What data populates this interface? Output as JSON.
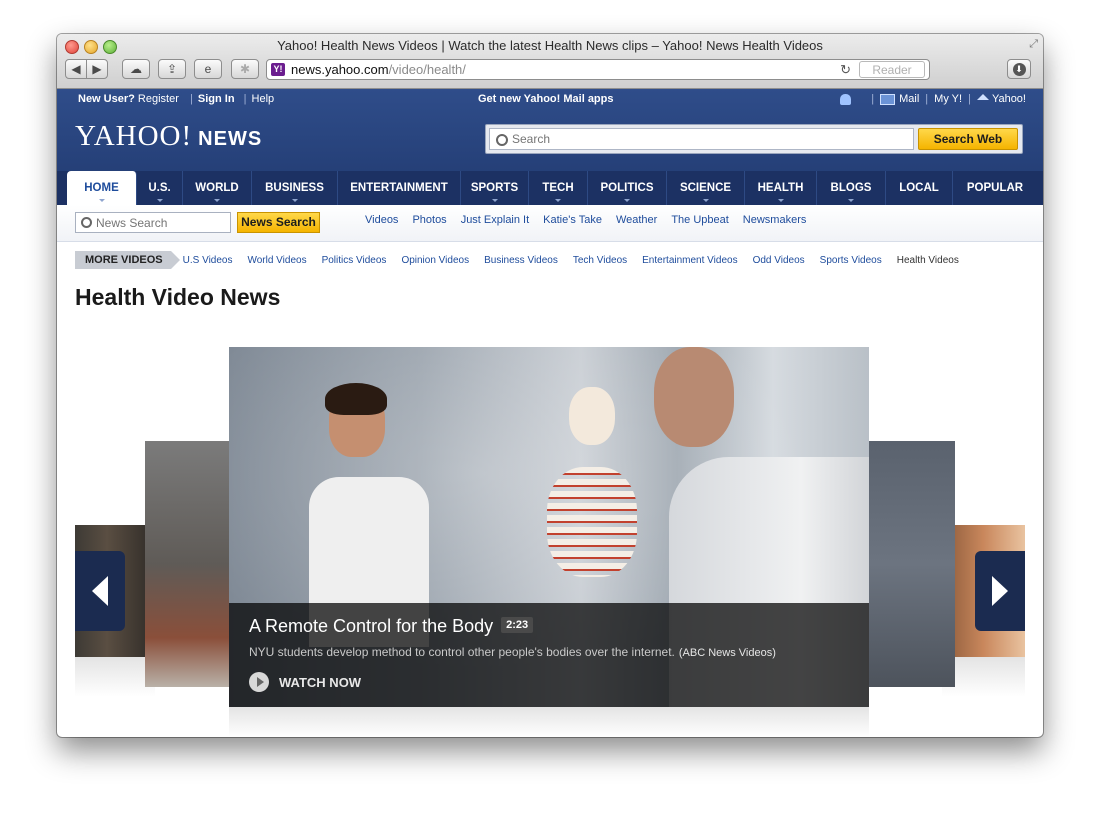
{
  "window": {
    "title": "Yahoo! Health News Videos | Watch the latest Health News clips – Yahoo! News Health Videos",
    "url_host": "news.yahoo.com",
    "url_path": "/video/health/",
    "reader_label": "Reader"
  },
  "header": {
    "new_user": "New User?",
    "register": "Register",
    "sign_in": "Sign In",
    "help": "Help",
    "mail_apps": "Get new Yahoo! Mail apps",
    "mail": "Mail",
    "my_y": "My Y!",
    "yahoo": "Yahoo!",
    "logo": "YAHOO!",
    "logo_news": "NEWS",
    "search_placeholder": "Search",
    "search_button": "Search Web"
  },
  "nav": {
    "items": [
      {
        "label": "HOME"
      },
      {
        "label": "U.S."
      },
      {
        "label": "WORLD"
      },
      {
        "label": "BUSINESS"
      },
      {
        "label": "ENTERTAINMENT"
      },
      {
        "label": "SPORTS"
      },
      {
        "label": "TECH"
      },
      {
        "label": "POLITICS"
      },
      {
        "label": "SCIENCE"
      },
      {
        "label": "HEALTH"
      },
      {
        "label": "BLOGS"
      },
      {
        "label": "LOCAL"
      },
      {
        "label": "POPULAR"
      }
    ]
  },
  "subnav": {
    "search_placeholder": "News Search",
    "search_button": "News Search",
    "links": [
      "Videos",
      "Photos",
      "Just Explain It",
      "Katie's Take",
      "Weather",
      "The Upbeat",
      "Newsmakers"
    ]
  },
  "more_videos": {
    "label": "MORE VIDEOS",
    "links": [
      "U.S Videos",
      "World Videos",
      "Politics Videos",
      "Opinion Videos",
      "Business Videos",
      "Tech Videos",
      "Entertainment Videos",
      "Odd Videos",
      "Sports Videos",
      "Health Videos"
    ]
  },
  "page_title": "Health Video News",
  "featured": {
    "title": "A Remote Control for the Body",
    "duration": "2:23",
    "description": "NYU students develop method to control other people's bodies over the internet.",
    "source": "(ABC News Videos)",
    "watch_label": "WATCH NOW"
  },
  "colors": {
    "header_blue": "#2f4d8a",
    "nav_navy": "#1c3163",
    "link_blue": "#1e4c9c",
    "button_yellow": "#f5b400"
  }
}
